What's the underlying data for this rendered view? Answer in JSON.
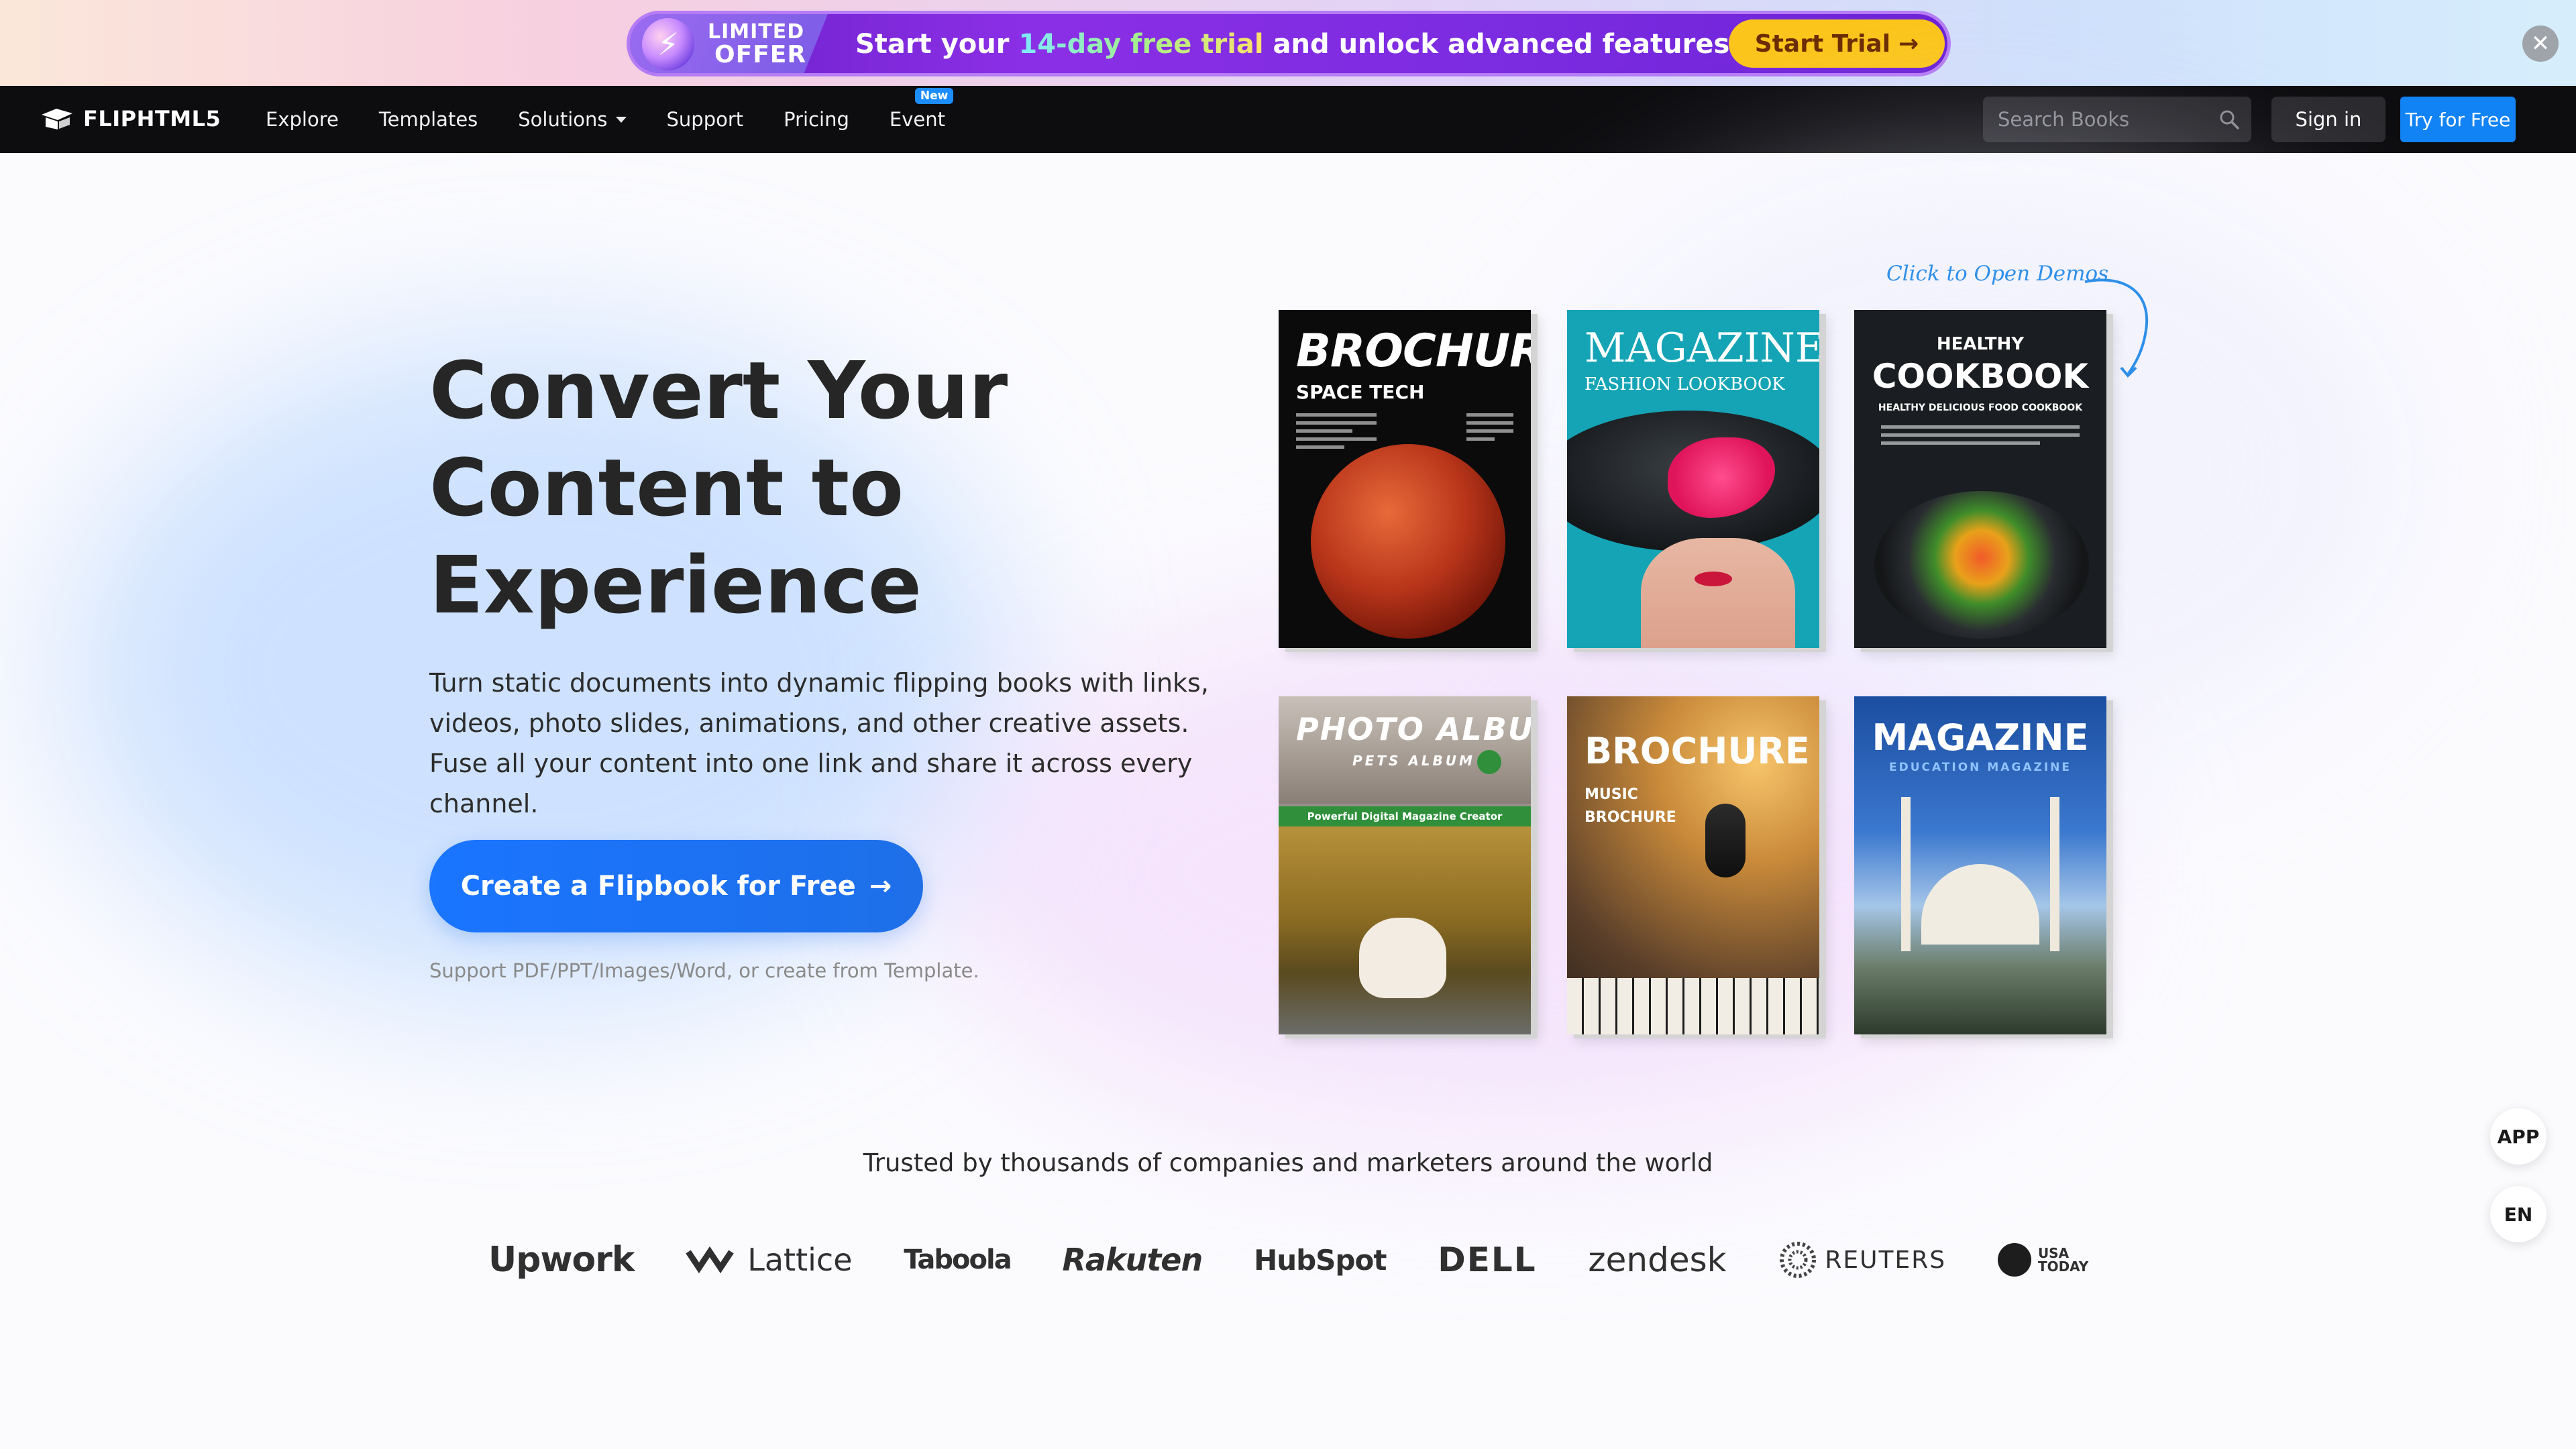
{
  "promo": {
    "badge_line1": "LIMITED",
    "badge_line2": "OFFER",
    "msg_part1": "Start your ",
    "msg_highlight": "14-day free trial",
    "msg_part2": " and unlock advanced features now!",
    "cta_label": "Start Trial",
    "cta_arrow": "→",
    "close_glyph": "✕",
    "accent_color": "#7a2be0",
    "cta_color": "#fbc51b"
  },
  "nav": {
    "logo_text": "FLIPHTML5",
    "items": [
      {
        "label": "Explore"
      },
      {
        "label": "Templates"
      },
      {
        "label": "Solutions"
      },
      {
        "label": "Support"
      },
      {
        "label": "Pricing"
      },
      {
        "label": "Event",
        "badge": "New"
      }
    ],
    "search_placeholder": "Search Books",
    "signin_label": "Sign in",
    "tryfree_label": "Try for Free",
    "tryfree_color": "#1283f5"
  },
  "hero": {
    "title_line1": "Convert Your",
    "title_line2": "Content to",
    "title_line3": "Experience",
    "description": "Turn static documents into dynamic flipping books with links, videos, photo slides, animations, and other creative assets. Fuse all your content into one link and share it across every channel.",
    "cta_label": "Create a Flipbook for Free",
    "cta_arrow": "→",
    "support_note": "Support PDF/PPT/Images/Word, or create from Template.",
    "cta_color": "#1a75ff"
  },
  "demos": {
    "hint": "Click to Open Demos",
    "books": [
      {
        "title": "BROCHURE",
        "subtitle": "SPACE TECH"
      },
      {
        "title": "MAGAZINE",
        "subtitle": "FASHION LOOKBOOK"
      },
      {
        "kicker": "HEALTHY",
        "title": "COOKBOOK",
        "subtitle": "HEALTHY DELICIOUS FOOD COOKBOOK"
      },
      {
        "title": "PHOTO ALBUM",
        "subtitle": "PETS ALBUM",
        "strip": "Powerful Digital Magazine Creator"
      },
      {
        "title": "BROCHURE",
        "subtitle": "MUSIC BROCHURE"
      },
      {
        "title": "MAGAZINE",
        "subtitle": "EDUCATION MAGAZINE"
      }
    ]
  },
  "trusted": {
    "heading": "Trusted by thousands of companies and marketers around the world",
    "logos": [
      "Upwork",
      "Lattice",
      "Taboola",
      "Rakuten",
      "HubSpot",
      "DELL",
      "zendesk",
      "REUTERS",
      "USA TODAY"
    ]
  },
  "side": {
    "app_label": "APP",
    "lang_label": "EN"
  }
}
